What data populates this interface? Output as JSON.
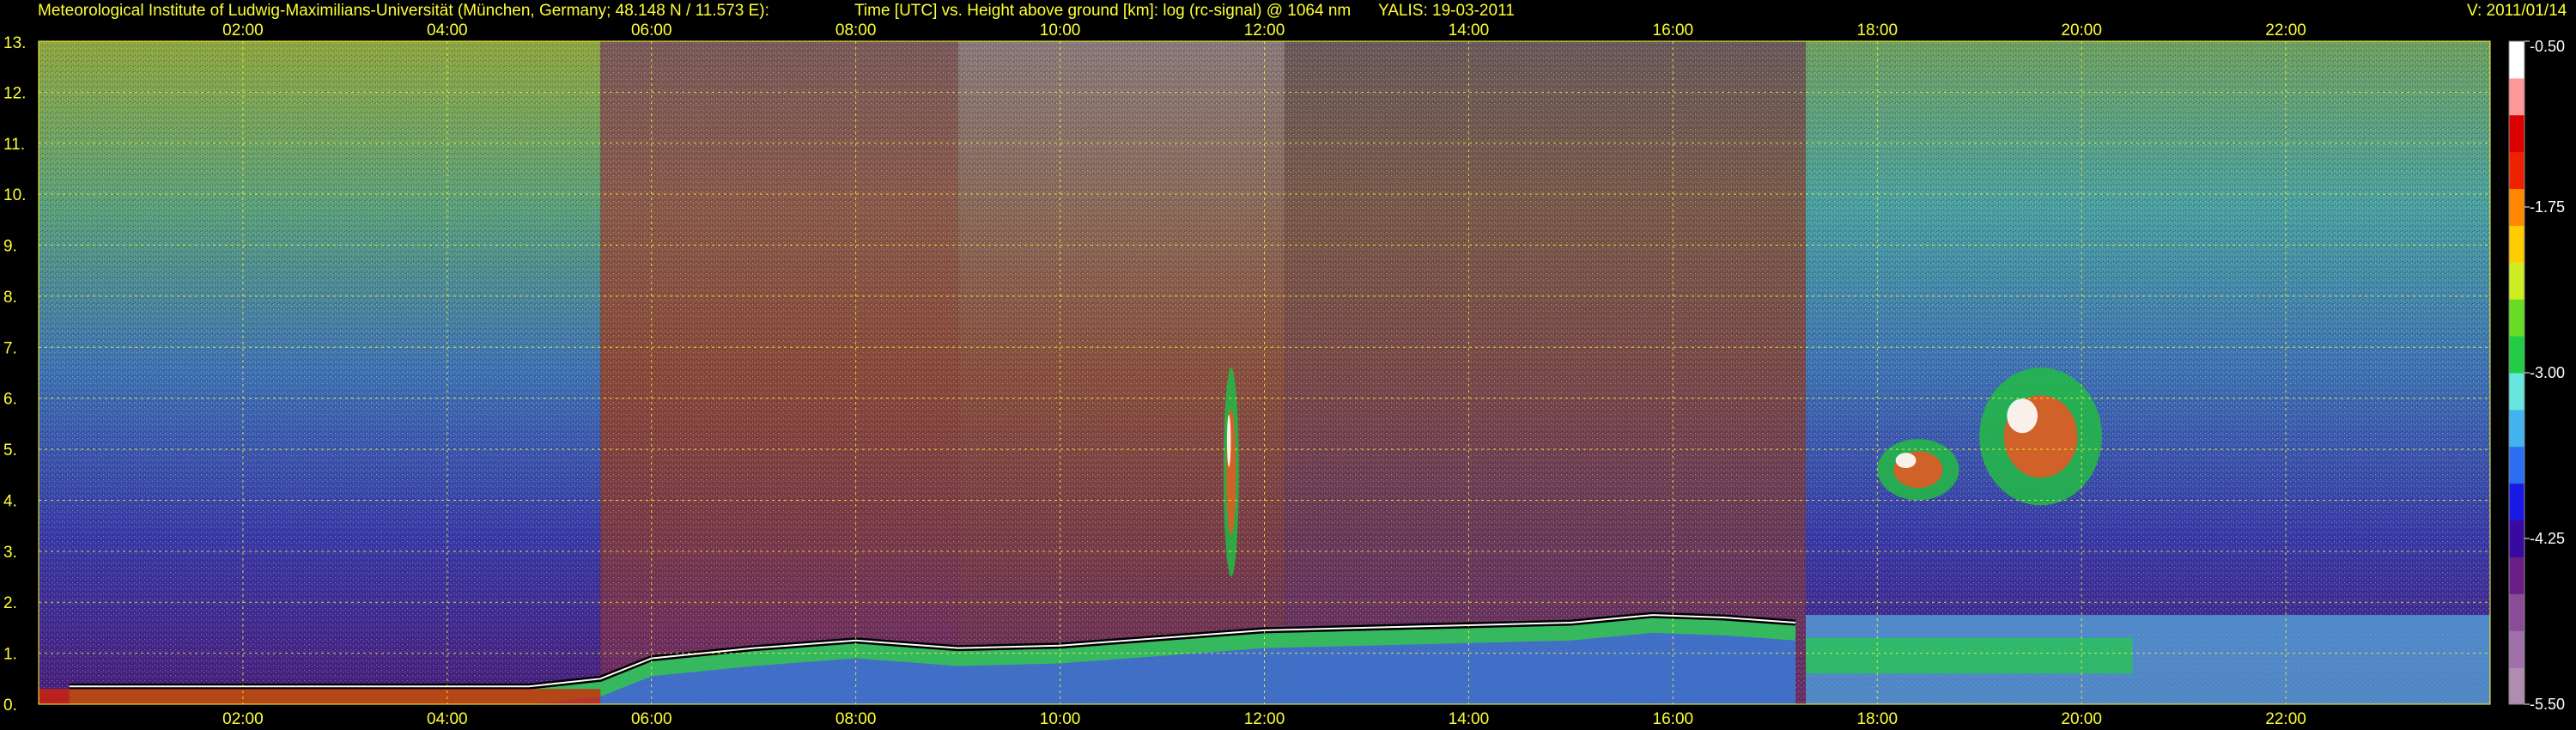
{
  "header": {
    "institute": "Meteorological Institute of Ludwig-Maximilians-Universität (München, Germany; 48.148 N / 11.573 E):",
    "title": "Time [UTC] vs. Height above ground [km]: log (rc-signal) @ 1064 nm",
    "station": "YALIS: 19-03-2011",
    "version": "V: 2011/01/14"
  },
  "chart_data": {
    "type": "heatmap",
    "title": "Time [UTC] vs. Height above ground [km]: log (rc-signal) @ 1064 nm",
    "xlabel": "Time [UTC]",
    "ylabel": "Height above ground [km]",
    "x_unit": "hour UTC",
    "xlim": [
      0,
      24
    ],
    "ylim": [
      0,
      13
    ],
    "x_ticks": [
      2,
      4,
      6,
      8,
      10,
      12,
      14,
      16,
      18,
      20,
      22
    ],
    "x_tick_labels": [
      "02:00",
      "04:00",
      "06:00",
      "08:00",
      "10:00",
      "12:00",
      "14:00",
      "16:00",
      "18:00",
      "20:00",
      "22:00"
    ],
    "y_ticks": [
      0,
      1,
      2,
      3,
      4,
      5,
      6,
      7,
      8,
      9,
      10,
      11,
      12,
      13
    ],
    "y_tick_labels": [
      "0.",
      "1.",
      "2.",
      "3.",
      "4.",
      "5.",
      "6.",
      "7.",
      "8.",
      "9.",
      "10.",
      "11.",
      "12.",
      "13."
    ],
    "grid": true,
    "colorbar": {
      "range": [
        -5.5,
        -0.5
      ],
      "ticks": [
        -0.5,
        -1.75,
        -3.0,
        -4.25,
        -5.5
      ],
      "tick_labels": [
        "-0.50",
        "-1.75",
        "-3.00",
        "-4.25",
        "-5.50"
      ],
      "colors": [
        "#b08cb0",
        "#a070a8",
        "#8a4c96",
        "#6a1f86",
        "#3a0aa0",
        "#1a1ae6",
        "#2a70f0",
        "#44b4f0",
        "#66e6dc",
        "#22cc44",
        "#66dd22",
        "#ccee22",
        "#ffcc00",
        "#ff8800",
        "#ee2200",
        "#dd0000",
        "#ff9999",
        "#ffffff"
      ]
    },
    "features": {
      "boundary_layer_top": [
        [
          0.3,
          0.35
        ],
        [
          2.0,
          0.35
        ],
        [
          4.0,
          0.35
        ],
        [
          4.8,
          0.35
        ],
        [
          5.5,
          0.5
        ],
        [
          6.0,
          0.9
        ],
        [
          7.0,
          1.1
        ],
        [
          8.0,
          1.25
        ],
        [
          9.0,
          1.1
        ],
        [
          10.0,
          1.15
        ],
        [
          11.0,
          1.3
        ],
        [
          12.0,
          1.45
        ],
        [
          13.0,
          1.5
        ],
        [
          14.0,
          1.55
        ],
        [
          15.0,
          1.6
        ],
        [
          15.8,
          1.75
        ],
        [
          16.5,
          1.7
        ],
        [
          17.2,
          1.6
        ]
      ],
      "clouds": [
        {
          "t_start": 19.0,
          "t_end": 20.2,
          "h_bottom": 3.9,
          "h_top": 6.6
        },
        {
          "t_start": 18.0,
          "t_end": 18.8,
          "h_bottom": 4.0,
          "h_top": 5.2
        },
        {
          "t_start": 11.6,
          "t_end": 11.75,
          "h_bottom": 2.5,
          "h_top": 6.6
        }
      ]
    }
  }
}
